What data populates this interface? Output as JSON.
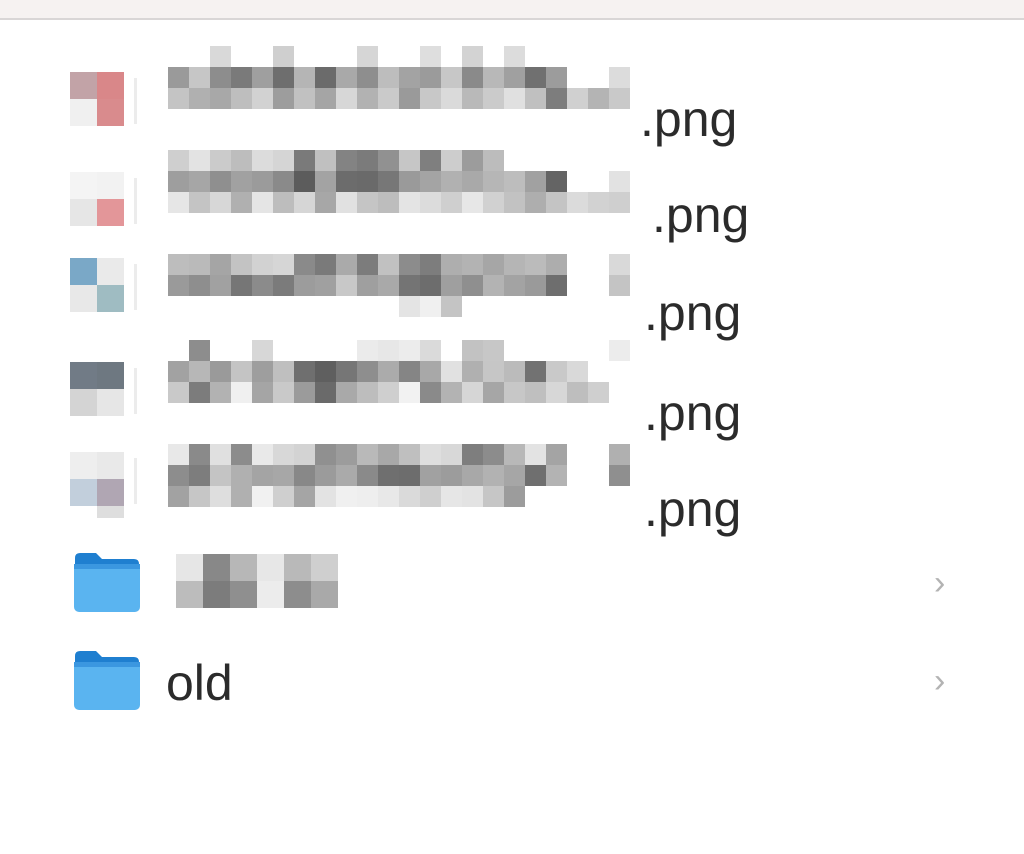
{
  "files": [
    {
      "suffix": ".png",
      "thumb_colors": [
        "#c2a3a7",
        "#d98789",
        "#f0f0f0",
        "#d98b8d"
      ]
    },
    {
      "suffix": ".png",
      "thumb_colors": [
        "#f4f4f4",
        "#f2f2f2",
        "#e6e6e6",
        "#e39699"
      ]
    },
    {
      "suffix": ".png",
      "thumb_colors": [
        "#7aa8c7",
        "#eaeaea",
        "#e8e8e8",
        "#9fbcc2"
      ]
    },
    {
      "suffix": ".png",
      "thumb_colors": [
        "#717b86",
        "#6e7881",
        "#d4d4d4",
        "#e6e6e6"
      ]
    },
    {
      "suffix": ".png",
      "thumb_colors": [
        "#eeeeee",
        "#e9e9e9",
        "#c2cfdc",
        "#b0a6b3"
      ]
    }
  ],
  "folders": [
    {
      "name": ""
    },
    {
      "name": "old"
    }
  ],
  "icons": {
    "folder": "folder-icon",
    "chevron": "chevron-right-icon"
  },
  "colors": {
    "folder_top": "#1f7fd0",
    "folder_body": "#5ab4f0",
    "text": "#2b2b2b",
    "chevron": "#b3b3b3"
  }
}
